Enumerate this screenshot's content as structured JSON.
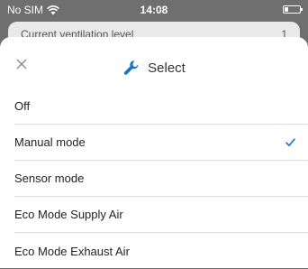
{
  "status_bar": {
    "carrier": "No SIM",
    "time": "14:08",
    "wifi_icon": "wifi-icon",
    "battery_icon": "battery-icon"
  },
  "background_card": {
    "label": "Current ventilation level",
    "value": "1"
  },
  "sheet": {
    "title": "Select",
    "title_icon": "wrench-icon",
    "close_icon": "close-icon",
    "accent_color": "#1a73c9",
    "options": [
      {
        "label": "Off",
        "selected": false
      },
      {
        "label": "Manual mode",
        "selected": true
      },
      {
        "label": "Sensor mode",
        "selected": false
      },
      {
        "label": "Eco Mode Supply Air",
        "selected": false
      },
      {
        "label": "Eco Mode Exhaust Air",
        "selected": false
      }
    ]
  }
}
